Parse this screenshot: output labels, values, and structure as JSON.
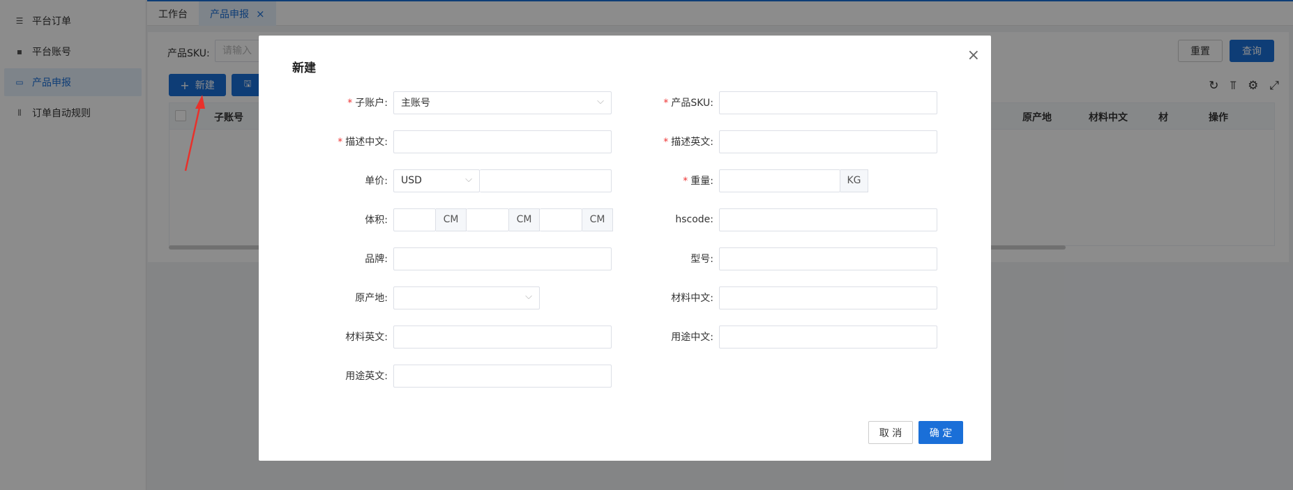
{
  "sidebar": {
    "items": [
      {
        "icon": "list-icon",
        "glyph": "☰",
        "label": "平台订单"
      },
      {
        "icon": "card-icon",
        "glyph": "▪",
        "label": "平台账号"
      },
      {
        "icon": "monitor-icon",
        "glyph": "▭",
        "label": "产品申报"
      },
      {
        "icon": "bar-chart-icon",
        "glyph": "⫴",
        "label": "订单自动规则"
      }
    ]
  },
  "tabs": [
    {
      "label": "工作台"
    },
    {
      "label": "产品申报",
      "close": "×"
    }
  ],
  "filter": {
    "sku_label": "产品SKU:",
    "sku_placeholder": "请输入",
    "reset_label": "重置",
    "query_label": "查询"
  },
  "toolbar": {
    "new_icon": "+",
    "new_label": "新建",
    "save_icon": "🖫"
  },
  "table": {
    "headers": [
      "子账号",
      "原产地",
      "材料中文",
      "材",
      "操作"
    ]
  },
  "modal": {
    "title": "新建",
    "close": "×",
    "fields": {
      "sub_account": {
        "label": "子账户:",
        "value": "主账号"
      },
      "product_sku": {
        "label": "产品SKU:"
      },
      "desc_cn": {
        "label": "描述中文:"
      },
      "desc_en": {
        "label": "描述英文:"
      },
      "unit_price": {
        "label": "单价:",
        "currency": "USD"
      },
      "weight": {
        "label": "重量:",
        "unit": "KG"
      },
      "volume": {
        "label": "体积:",
        "unit": "CM"
      },
      "hscode": {
        "label": "hscode:"
      },
      "brand": {
        "label": "品牌:"
      },
      "model": {
        "label": "型号:"
      },
      "origin": {
        "label": "原产地:"
      },
      "material_cn": {
        "label": "材料中文:"
      },
      "material_en": {
        "label": "材料英文:"
      },
      "usage_cn": {
        "label": "用途中文:"
      },
      "usage_en": {
        "label": "用途英文:"
      }
    },
    "required_mark": "*",
    "cancel_label": "取 消",
    "confirm_label": "确 定"
  },
  "colors": {
    "primary": "#1a6fd8",
    "required": "#ee3333",
    "annotation_arrow": "#e8312b"
  }
}
